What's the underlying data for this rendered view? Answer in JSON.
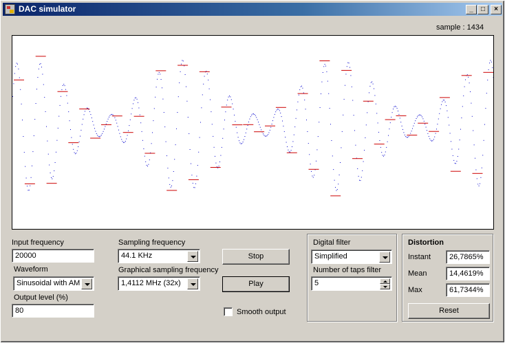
{
  "window": {
    "title": "DAC simulator",
    "minimize_glyph": "_",
    "maximize_glyph": "□",
    "close_glyph": "×"
  },
  "sample_label": "sample : 1434",
  "input_frequency": {
    "label": "Input frequency",
    "value": "20000"
  },
  "waveform": {
    "label": "Waveform",
    "value": "Sinusoidal with AM"
  },
  "output_level": {
    "label": "Output level (%)",
    "value": "80"
  },
  "sampling_frequency": {
    "label": "Sampling frequency",
    "value": "44.1 KHz"
  },
  "graphical_sampling_frequency": {
    "label": "Graphical sampling frequency",
    "value": "1,4112 MHz (32x)"
  },
  "buttons": {
    "stop": "Stop",
    "play": "Play",
    "reset": "Reset"
  },
  "smooth_output": {
    "label": "Smooth output",
    "checked": false
  },
  "digital_filter": {
    "group_label": "Digital filter",
    "value": "Simplified",
    "taps_label": "Number of taps filter",
    "taps_value": "5"
  },
  "distortion": {
    "group_label": "Distortion",
    "instant_label": "Instant",
    "instant_value": "26,7865%",
    "mean_label": "Mean",
    "mean_value": "14,4619%",
    "max_label": "Max",
    "max_value": "61,7344%"
  },
  "colors": {
    "analog_wave": "#0000cc",
    "samples": "#cc0000",
    "title_start": "#0a246a",
    "title_end": "#a6caf0"
  }
}
